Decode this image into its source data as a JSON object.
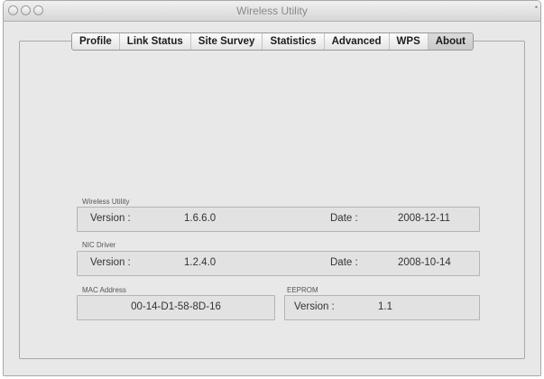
{
  "window": {
    "title": "Wireless Utility"
  },
  "tabs": [
    "Profile",
    "Link Status",
    "Site Survey",
    "Statistics",
    "Advanced",
    "WPS",
    "About"
  ],
  "active_tab": "About",
  "wireless_utility": {
    "group_label": "Wireless Utility",
    "version_label": "Version :",
    "version": "1.6.6.0",
    "date_label": "Date :",
    "date": "2008-12-11"
  },
  "nic_driver": {
    "group_label": "NIC Driver",
    "version_label": "Version :",
    "version": "1.2.4.0",
    "date_label": "Date :",
    "date": "2008-10-14"
  },
  "mac": {
    "group_label": "MAC Address",
    "value": "00-14-D1-58-8D-16"
  },
  "eeprom": {
    "group_label": "EEPROM",
    "version_label": "Version :",
    "version": "1.1"
  }
}
